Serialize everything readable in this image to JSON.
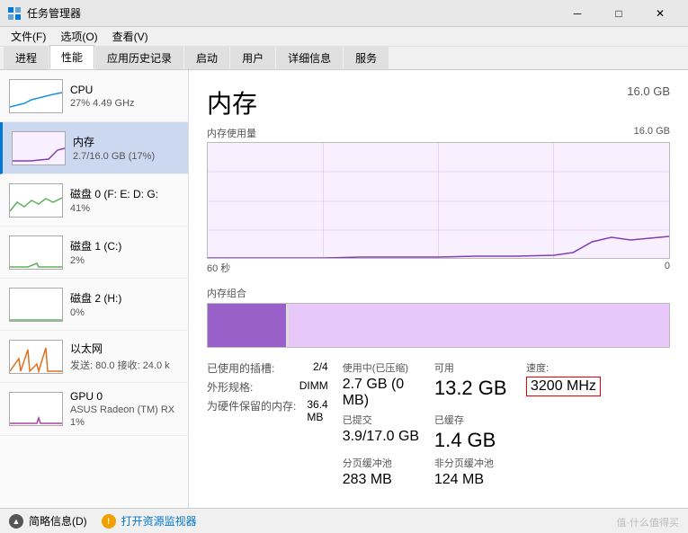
{
  "titlebar": {
    "title": "任务管理器",
    "minimize": "─",
    "maximize": "□",
    "close": "✕"
  },
  "menubar": {
    "items": [
      "文件(F)",
      "选项(O)",
      "查看(V)"
    ]
  },
  "tabs": {
    "items": [
      "进程",
      "性能",
      "应用历史记录",
      "启动",
      "用户",
      "详细信息",
      "服务"
    ],
    "active": 1
  },
  "sidebar": {
    "items": [
      {
        "id": "cpu",
        "name": "CPU",
        "value": "27% 4.49 GHz",
        "graph_color": "#1a8fe0"
      },
      {
        "id": "mem",
        "name": "内存",
        "value": "2.7/16.0 GB (17%)",
        "graph_color": "#8040b0",
        "active": true
      },
      {
        "id": "disk0",
        "name": "磁盘 0 (F: E: D: G:",
        "value": "41%",
        "graph_color": "#60b060"
      },
      {
        "id": "disk1",
        "name": "磁盘 1 (C:)",
        "value": "2%",
        "graph_color": "#60b060"
      },
      {
        "id": "disk2",
        "name": "磁盘 2 (H:)",
        "value": "0%",
        "graph_color": "#60b060"
      },
      {
        "id": "eth",
        "name": "以太网",
        "value": "发送: 80.0  接收: 24.0 k",
        "graph_color": "#e07020"
      },
      {
        "id": "gpu0",
        "name": "GPU 0",
        "value": "ASUS Radeon (TM) RX",
        "value2": "1%",
        "graph_color": "#b040a0"
      }
    ]
  },
  "panel": {
    "title": "内存",
    "total": "16.0 GB",
    "chart_label_left": "内存使用量",
    "chart_label_right": "16.0 GB",
    "chart_time_left": "60 秒",
    "chart_time_right": "0",
    "composition_label": "内存组合",
    "stats": [
      {
        "label": "使用中(已压缩)",
        "value": "2.7 GB (0 MB)"
      },
      {
        "label": "可用",
        "value": "13.2 GB"
      },
      {
        "label": "速度:",
        "value": "3200 MHz",
        "highlight": true
      }
    ],
    "stats2": [
      {
        "label": "已提交",
        "value": "3.9/17.0 GB"
      },
      {
        "label": "已缓存",
        "value": "1.4 GB"
      },
      {
        "label": "已使用的插槽:",
        "value": "2/4"
      }
    ],
    "stats3": [
      {
        "label": "分页缓冲池",
        "value": "283 MB"
      },
      {
        "label": "非分页缓冲池",
        "value": "124 MB"
      },
      {
        "label": "外形规格:",
        "value": "DIMM"
      }
    ],
    "stats4": [
      {
        "label": "",
        "value": ""
      },
      {
        "label": "",
        "value": ""
      },
      {
        "label": "为硬件保留的内存:",
        "value": "36.4 MB"
      }
    ]
  },
  "bottombar": {
    "summary_label": "简略信息(D)",
    "monitor_label": "打开资源监视器"
  },
  "watermark": "值·什么值得买"
}
